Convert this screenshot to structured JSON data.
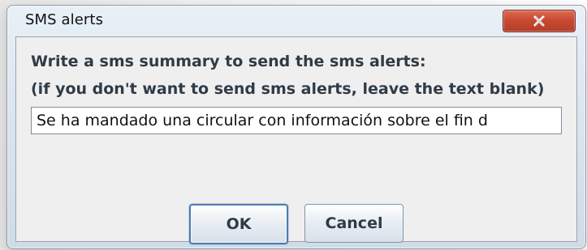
{
  "window": {
    "title": "SMS alerts"
  },
  "titlebar": {
    "close_icon": "close-icon"
  },
  "dialog": {
    "line1": "Write a sms summary to send the sms alerts:",
    "line2": "(if you don't want to send sms alerts, leave the text blank)",
    "input_value": "Se ha mandado una circular con información sobre el fin d",
    "ok_label": "OK",
    "cancel_label": "Cancel"
  },
  "colors": {
    "close_red": "#c84a33",
    "text": "#2f3b46",
    "focus_blue": "#4b7db1"
  }
}
